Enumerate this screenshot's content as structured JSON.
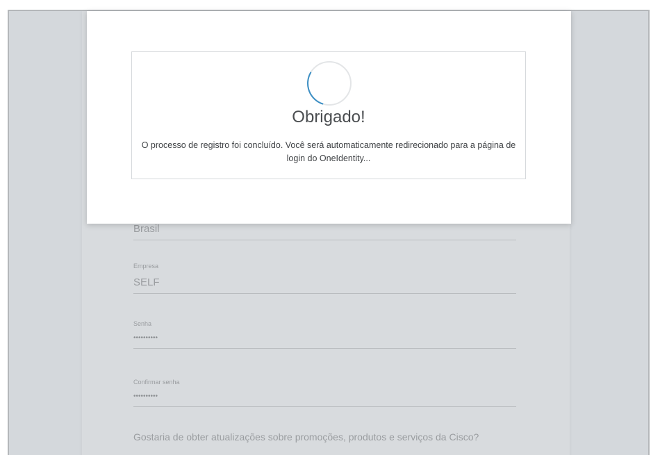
{
  "modal": {
    "title": "Obrigado!",
    "message": "O processo de registro foi concluído. Você será automaticamente redirecionado para a página de login do OneIdentity...",
    "spinner_color": "#3c8fc4"
  },
  "form": {
    "country": {
      "value": "Brasil"
    },
    "company": {
      "label": "Empresa",
      "value": "SELF"
    },
    "password": {
      "label": "Senha",
      "value": "••••••••••"
    },
    "confirm_password": {
      "label": "Confirmar senha",
      "value": "••••••••••"
    },
    "updates_question": "Gostaria de obter atualizações sobre promoções, produtos e serviços da Cisco?"
  }
}
